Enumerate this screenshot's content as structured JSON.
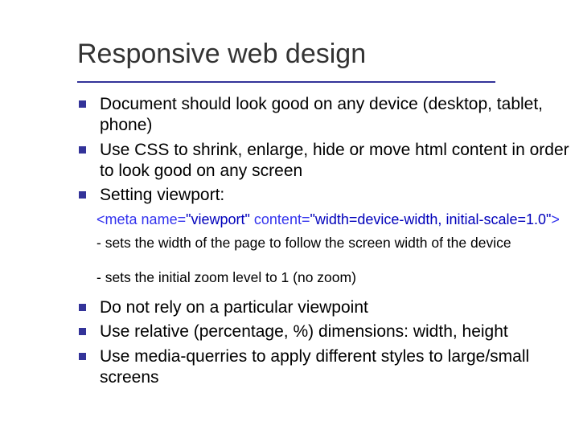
{
  "title": "Responsive web design",
  "bullets_a": [
    "Document should look good on any device (desktop, tablet, phone)",
    "Use CSS to shrink, enlarge, hide or move html content in order to look good on any screen",
    "Setting viewport:"
  ],
  "code": {
    "open": "<",
    "tag": "meta",
    "a1": " name",
    "eq": "=",
    "v1": "\"viewport\"",
    "a2": " content",
    "v2": "\"width=device-width, initial-scale=1.0\"",
    "close": ">"
  },
  "subnotes": [
    "- sets the width of the page to follow the screen width of the device",
    "- sets the initial zoom level to 1 (no zoom)"
  ],
  "bullets_b": [
    "Do not rely on a particular viewpoint",
    "Use relative (percentage, %) dimensions: width, height",
    "Use media-querries to apply different styles to large/small screens"
  ]
}
